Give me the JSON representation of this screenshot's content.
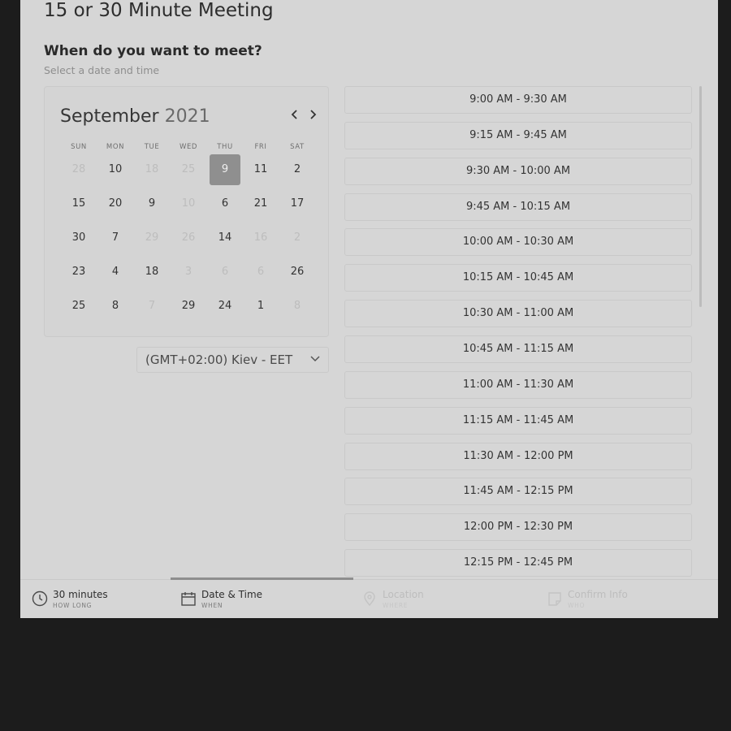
{
  "page": {
    "title": "15 or 30 Minute Meeting",
    "section_heading": "When do you want to meet?",
    "section_subtitle": "Select a date and time"
  },
  "calendar": {
    "month": "September",
    "year": "2021",
    "prev_icon": "chevron-left-icon",
    "next_icon": "chevron-right-icon",
    "weekdays": [
      "SUN",
      "MON",
      "TUE",
      "WED",
      "THU",
      "FRI",
      "SAT"
    ],
    "weeks": [
      [
        {
          "d": "28",
          "disabled": true
        },
        {
          "d": "10",
          "disabled": false
        },
        {
          "d": "18",
          "disabled": true
        },
        {
          "d": "25",
          "disabled": true
        },
        {
          "d": "9",
          "disabled": false,
          "selected": true
        },
        {
          "d": "11",
          "disabled": false
        },
        {
          "d": "2",
          "disabled": false
        }
      ],
      [
        {
          "d": "15",
          "disabled": false
        },
        {
          "d": "20",
          "disabled": false
        },
        {
          "d": "9",
          "disabled": false
        },
        {
          "d": "10",
          "disabled": true
        },
        {
          "d": "6",
          "disabled": false
        },
        {
          "d": "21",
          "disabled": false
        },
        {
          "d": "17",
          "disabled": false
        }
      ],
      [
        {
          "d": "30",
          "disabled": false
        },
        {
          "d": "7",
          "disabled": false
        },
        {
          "d": "29",
          "disabled": true
        },
        {
          "d": "26",
          "disabled": true
        },
        {
          "d": "14",
          "disabled": false
        },
        {
          "d": "16",
          "disabled": true
        },
        {
          "d": "2",
          "disabled": true
        }
      ],
      [
        {
          "d": "23",
          "disabled": false
        },
        {
          "d": "4",
          "disabled": false
        },
        {
          "d": "18",
          "disabled": false
        },
        {
          "d": "3",
          "disabled": true
        },
        {
          "d": "6",
          "disabled": true
        },
        {
          "d": "6",
          "disabled": true
        },
        {
          "d": "26",
          "disabled": false
        }
      ],
      [
        {
          "d": "25",
          "disabled": false
        },
        {
          "d": "8",
          "disabled": false
        },
        {
          "d": "7",
          "disabled": true
        },
        {
          "d": "29",
          "disabled": false
        },
        {
          "d": "24",
          "disabled": false
        },
        {
          "d": "1",
          "disabled": false
        },
        {
          "d": "8",
          "disabled": true
        }
      ]
    ]
  },
  "timezone": {
    "selected": "(GMT+02:00) Kiev - EET",
    "icon": "chevron-down-icon"
  },
  "time_slots": [
    "9:00 AM - 9:30 AM",
    "9:15 AM - 9:45 AM",
    "9:30 AM - 10:00 AM",
    "9:45 AM - 10:15 AM",
    "10:00 AM - 10:30 AM",
    "10:15 AM - 10:45 AM",
    "10:30 AM - 11:00 AM",
    "10:45 AM - 11:15 AM",
    "11:00 AM - 11:30 AM",
    "11:15 AM - 11:45 AM",
    "11:30 AM - 12:00 PM",
    "11:45 AM - 12:15 PM",
    "12:00 PM - 12:30 PM",
    "12:15 PM - 12:45 PM"
  ],
  "steps": [
    {
      "title": "30 minutes",
      "sub": "HOW LONG",
      "icon": "clock-icon",
      "active": true
    },
    {
      "title": "Date & Time",
      "sub": "WHEN",
      "icon": "calendar-icon",
      "active": true,
      "current": true
    },
    {
      "title": "Location",
      "sub": "WHERE",
      "icon": "map-pin-icon",
      "active": false
    },
    {
      "title": "Confirm Info",
      "sub": "WHO",
      "icon": "note-icon",
      "active": false
    }
  ],
  "colors": {
    "background": "#1c1c1c",
    "panel": "#d6d6d6",
    "selected_day": "#8f8f8f",
    "disabled_text": "#bdbdbd"
  }
}
